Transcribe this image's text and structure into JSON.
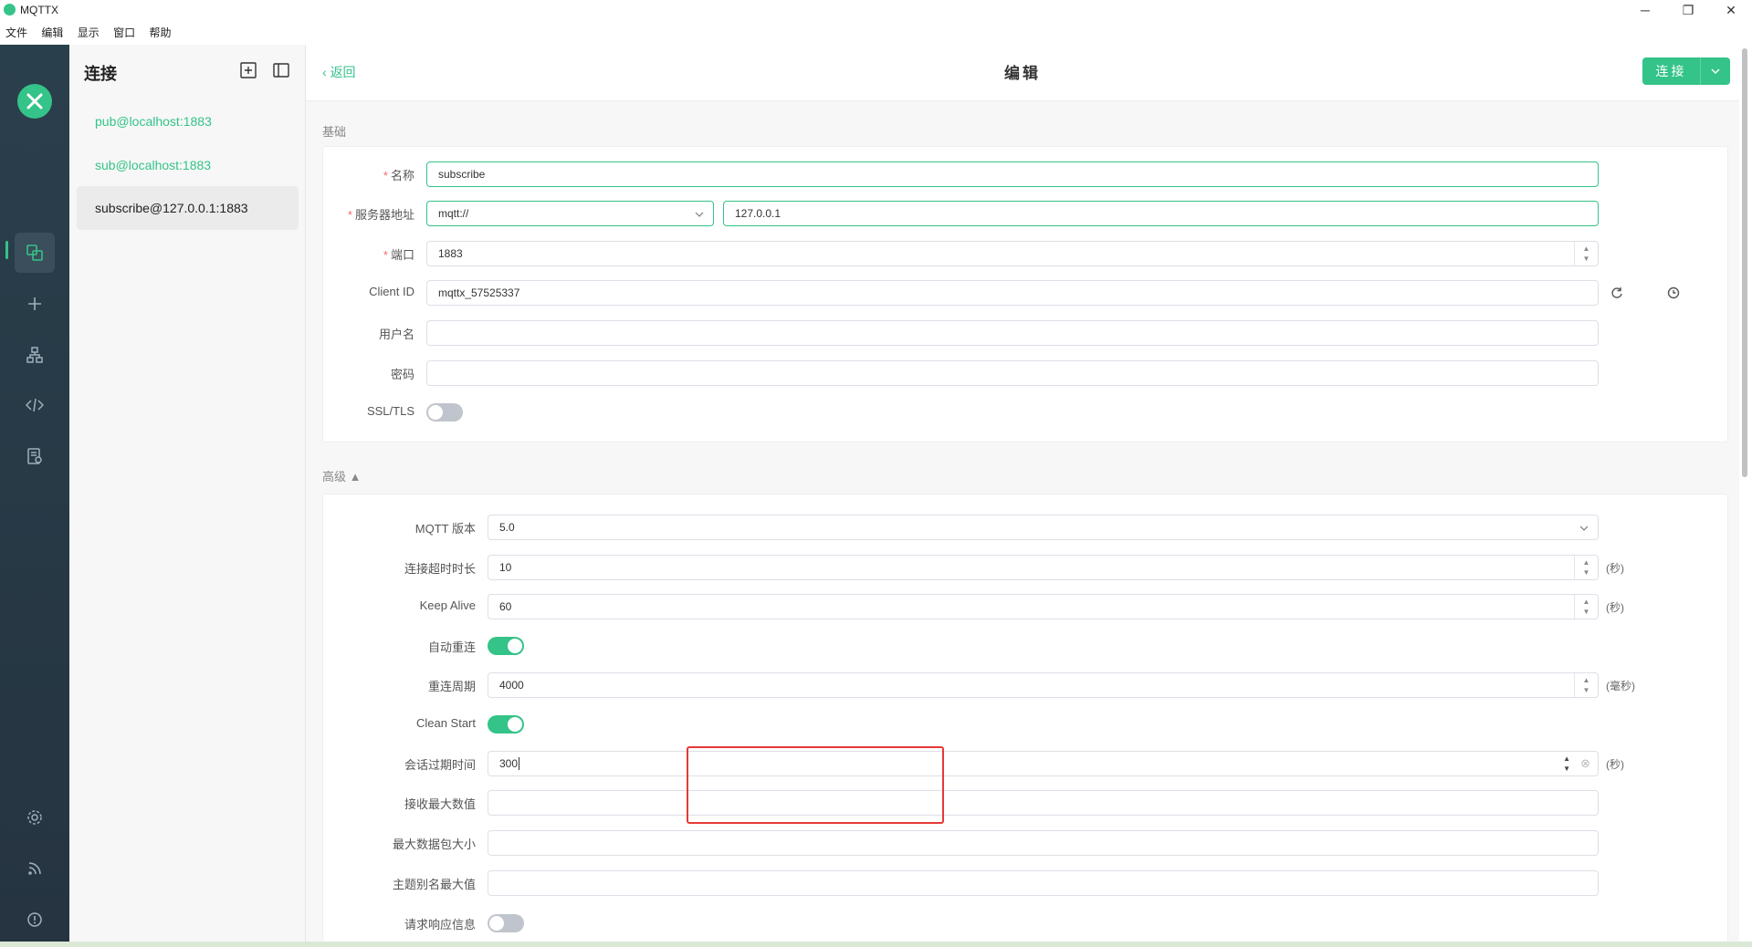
{
  "window": {
    "title": "MQTTX",
    "minimize": "─",
    "maximize": "❐",
    "close": "✕"
  },
  "menu": [
    "文件",
    "编辑",
    "显示",
    "窗口",
    "帮助"
  ],
  "connections_panel": {
    "title": "连接",
    "items": [
      "pub@localhost:1883",
      "sub@localhost:1883",
      "subscribe@127.0.0.1:1883"
    ]
  },
  "header": {
    "back": "返回",
    "title": "编辑",
    "connect": "连接"
  },
  "basic": {
    "section_title": "基础",
    "name_label": "名称",
    "name_value": "subscribe",
    "host_label": "服务器地址",
    "protocol_value": "mqtt://",
    "host_value": "127.0.0.1",
    "port_label": "端口",
    "port_value": "1883",
    "client_id_label": "Client ID",
    "client_id_value": "mqttx_57525337",
    "username_label": "用户名",
    "username_value": "",
    "password_label": "密码",
    "password_value": "",
    "ssl_label": "SSL/TLS",
    "ssl_on": false
  },
  "advanced": {
    "section_title": "高级",
    "mqtt_version_label": "MQTT 版本",
    "mqtt_version_value": "5.0",
    "connect_timeout_label": "连接超时时长",
    "connect_timeout_value": "10",
    "keep_alive_label": "Keep Alive",
    "keep_alive_value": "60",
    "auto_reconnect_label": "自动重连",
    "auto_reconnect_on": true,
    "reconnect_period_label": "重连周期",
    "reconnect_period_value": "4000",
    "clean_start_label": "Clean Start",
    "clean_start_on": true,
    "session_expiry_label": "会话过期时间",
    "session_expiry_value": "300",
    "receive_max_label": "接收最大数值",
    "receive_max_value": "",
    "max_packet_label": "最大数据包大小",
    "max_packet_value": "",
    "topic_alias_label": "主题别名最大值",
    "topic_alias_value": "",
    "request_response_label": "请求响应信息",
    "request_response_on": false
  },
  "units": {
    "seconds": "(秒)",
    "milliseconds": "(毫秒)"
  },
  "colors": {
    "accent": "#34c388",
    "sidebar": "#2a3f4c",
    "highlight": "#e53935"
  }
}
